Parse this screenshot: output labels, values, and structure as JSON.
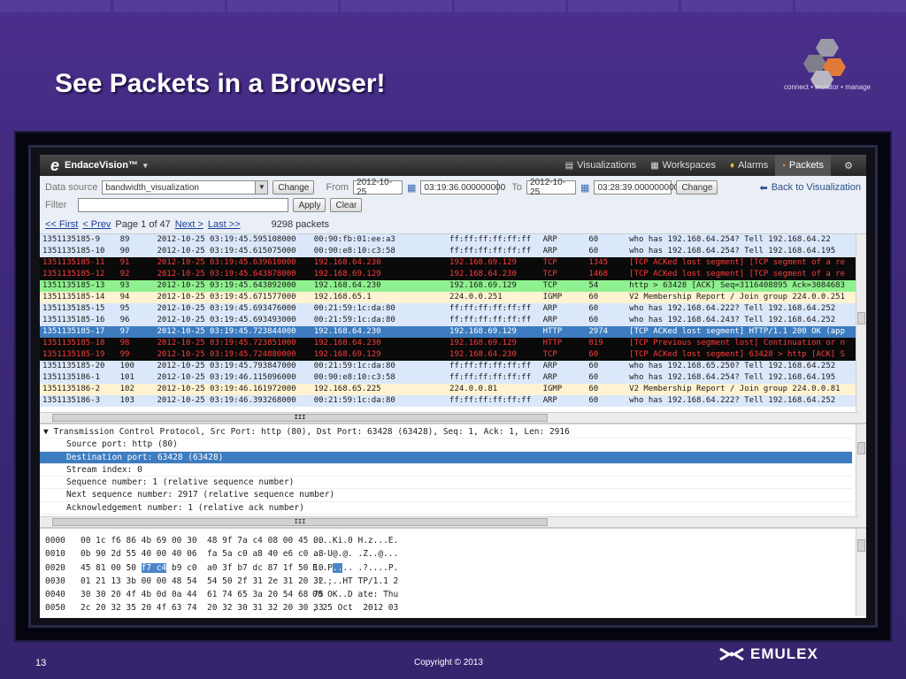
{
  "slide": {
    "title": "See Packets in a Browser!",
    "tagline": "connect • monitor • manage",
    "page_number": "13",
    "copyright": "Copyright © 2013",
    "company": "EMULEX"
  },
  "app": {
    "name": "EndaceVision™",
    "nav": [
      {
        "label": "Visualizations",
        "icon": "chart-icon"
      },
      {
        "label": "Workspaces",
        "icon": "grid-icon"
      },
      {
        "label": "Alarms",
        "icon": "bell-icon"
      },
      {
        "label": "Packets",
        "icon": "packets-icon"
      }
    ]
  },
  "controls": {
    "data_source_label": "Data source",
    "data_source_value": "bandwidth_visualization",
    "change_label": "Change",
    "from_label": "From",
    "from_date": "2012-10-25",
    "from_time": "03:19:36.000000000",
    "to_label": "To",
    "to_date": "2012-10-25",
    "to_time": "03:28:39.000000000",
    "change2_label": "Change",
    "back_label": "Back to Visualization",
    "filter_label": "Filter",
    "filter_value": "",
    "apply_label": "Apply",
    "clear_label": "Clear",
    "first_label": "<< First",
    "prev_label": "< Prev",
    "page_text": "Page 1 of 47",
    "next_label": "Next >",
    "last_label": "Last >>",
    "packet_count": "9298 packets"
  },
  "packets": [
    {
      "id": "1351135185-9",
      "no": "89",
      "time": "2012-10-25 03:19:45.595108000",
      "src": "00:90:fb:01:ee:a3",
      "dst": "ff:ff:ff:ff:ff:ff",
      "proto": "ARP",
      "len": "60",
      "info": "who has 192.168.64.254? Tell 192.168.64.22",
      "bg": "#dbe8fb",
      "fg": "#1a1a1a"
    },
    {
      "id": "1351135185-10",
      "no": "90",
      "time": "2012-10-25 03:19:45.615075000",
      "src": "00:90:e8:10:c3:58",
      "dst": "ff:ff:ff:ff:ff:ff",
      "proto": "ARP",
      "len": "60",
      "info": "who has 192.168.64.254? Tell 192.168.64.195",
      "bg": "#dbe8fb",
      "fg": "#1a1a1a"
    },
    {
      "id": "1351135185-11",
      "no": "91",
      "time": "2012-10-25 03:19:45.639610000",
      "src": "192.168.64.230",
      "dst": "192.168.69.129",
      "proto": "TCP",
      "len": "1345",
      "info": "[TCP ACKed lost segment] [TCP segment of a re",
      "bg": "#0a0a0a",
      "fg": "#ff3b3b"
    },
    {
      "id": "1351135185-12",
      "no": "92",
      "time": "2012-10-25 03:19:45.643878000",
      "src": "192.168.69.129",
      "dst": "192.168.64.230",
      "proto": "TCP",
      "len": "1468",
      "info": "[TCP ACKed lost segment] [TCP segment of a re",
      "bg": "#0a0a0a",
      "fg": "#ff3b3b"
    },
    {
      "id": "1351135185-13",
      "no": "93",
      "time": "2012-10-25 03:19:45.643892000",
      "src": "192.168.64.230",
      "dst": "192.168.69.129",
      "proto": "TCP",
      "len": "54",
      "info": "http > 63428 [ACK] Seq=3116408895 Ack=3084683",
      "bg": "#8ef08e",
      "fg": "#1a1a1a"
    },
    {
      "id": "1351135185-14",
      "no": "94",
      "time": "2012-10-25 03:19:45.671577000",
      "src": "192.168.65.1",
      "dst": "224.0.0.251",
      "proto": "IGMP",
      "len": "60",
      "info": "V2 Membership Report / Join group 224.0.0.251",
      "bg": "#fff3d2",
      "fg": "#1a1a1a"
    },
    {
      "id": "1351135185-15",
      "no": "95",
      "time": "2012-10-25 03:19:45.693476000",
      "src": "00:21:59:1c:da:80",
      "dst": "ff:ff:ff:ff:ff:ff",
      "proto": "ARP",
      "len": "60",
      "info": "who has 192.168.64.222? Tell 192.168.64.252",
      "bg": "#dbe8fb",
      "fg": "#1a1a1a"
    },
    {
      "id": "1351135185-16",
      "no": "96",
      "time": "2012-10-25 03:19:45.693493000",
      "src": "00:21:59:1c:da:80",
      "dst": "ff:ff:ff:ff:ff:ff",
      "proto": "ARP",
      "len": "60",
      "info": "who has 192.168.64.243? Tell 192.168.64.252",
      "bg": "#dbe8fb",
      "fg": "#1a1a1a"
    },
    {
      "id": "1351135185-17",
      "no": "97",
      "time": "2012-10-25 03:19:45.723844000",
      "src": "192.168.64.230",
      "dst": "192.168.69.129",
      "proto": "HTTP",
      "len": "2974",
      "info": "[TCP ACKed lost segment] HTTP/1.1 200 OK (app",
      "bg": "#3d7cc0",
      "fg": "#ffffff"
    },
    {
      "id": "1351135185-18",
      "no": "98",
      "time": "2012-10-25 03:19:45.723851000",
      "src": "192.168.64.230",
      "dst": "192.168.69.129",
      "proto": "HTTP",
      "len": "819",
      "info": "[TCP Previous segment lost] Continuation or n",
      "bg": "#0a0a0a",
      "fg": "#ff3b3b"
    },
    {
      "id": "1351135185-19",
      "no": "99",
      "time": "2012-10-25 03:19:45.724880000",
      "src": "192.168.69.129",
      "dst": "192.168.64.230",
      "proto": "TCP",
      "len": "60",
      "info": "[TCP ACKed lost segment] 63428 > http [ACK] S",
      "bg": "#0a0a0a",
      "fg": "#ff3b3b"
    },
    {
      "id": "1351135185-20",
      "no": "100",
      "time": "2012-10-25 03:19:45.793847000",
      "src": "00:21:59:1c:da:80",
      "dst": "ff:ff:ff:ff:ff:ff",
      "proto": "ARP",
      "len": "60",
      "info": "who has 192.168.65.250? Tell 192.168.64.252",
      "bg": "#dbe8fb",
      "fg": "#1a1a1a"
    },
    {
      "id": "1351135186-1",
      "no": "101",
      "time": "2012-10-25 03:19:46.115096000",
      "src": "00:90:e8:10:c3:58",
      "dst": "ff:ff:ff:ff:ff:ff",
      "proto": "ARP",
      "len": "60",
      "info": "who has 192.168.64.254? Tell 192.168.64.195",
      "bg": "#dbe8fb",
      "fg": "#1a1a1a"
    },
    {
      "id": "1351135186-2",
      "no": "102",
      "time": "2012-10-25 03:19:46.161972000",
      "src": "192.168.65.225",
      "dst": "224.0.0.81",
      "proto": "IGMP",
      "len": "60",
      "info": "V2 Membership Report / Join group 224.0.0.81",
      "bg": "#fff3d2",
      "fg": "#1a1a1a"
    },
    {
      "id": "1351135186-3",
      "no": "103",
      "time": "2012-10-25 03:19:46.393268000",
      "src": "00:21:59:1c:da:80",
      "dst": "ff:ff:ff:ff:ff:ff",
      "proto": "ARP",
      "len": "60",
      "info": "who has 192.168.64.222? Tell 192.168.64.252",
      "bg": "#dbe8fb",
      "fg": "#1a1a1a"
    }
  ],
  "scroll_glyph": "III",
  "details": [
    {
      "text": "▼ Transmission Control Protocol, Src Port: http (80), Dst Port: 63428 (63428), Seq: 1, Ack: 1, Len: 2916",
      "indent": 0,
      "selected": false
    },
    {
      "text": "Source port: http (80)",
      "indent": 1,
      "selected": false
    },
    {
      "text": "Destination port: 63428 (63428)",
      "indent": 1,
      "selected": true
    },
    {
      "text": "Stream index: 0",
      "indent": 1,
      "selected": false
    },
    {
      "text": "Sequence number: 1 (relative sequence number)",
      "indent": 1,
      "selected": false
    },
    {
      "text": "Next sequence number: 2917 (relative sequence number)",
      "indent": 1,
      "selected": false
    },
    {
      "text": "Acknowledgement number: 1 (relative ack number)",
      "indent": 1,
      "selected": false
    }
  ],
  "hex": [
    {
      "offset": "0000",
      "pre": "00 1c f6 86 4b 69 00 30  48 9f 7a c4 08 00 45 00",
      "hl": "",
      "post": "",
      "ascii_pre": "....Ki.0 H.z...E.",
      "ascii_hl": "",
      "ascii_post": ""
    },
    {
      "offset": "0010",
      "pre": "0b 90 2d 55 40 00 40 06  fa 5a c0 a8 40 e6 c0 a8",
      "hl": "",
      "post": "",
      "ascii_pre": "..-U@.@. .Z..@...",
      "ascii_hl": "",
      "ascii_post": ""
    },
    {
      "offset": "0020",
      "pre": "45 81 00 50 ",
      "hl": "f7 c4",
      "post": " b9 c0  a0 3f b7 dc 87 1f 50 10",
      "ascii_pre": "E..P",
      "ascii_hl": "..",
      "ascii_post": ".. .?....P.",
      "note": "highlighted bytes"
    },
    {
      "offset": "0030",
      "pre": "01 21 13 3b 00 00 48 54  54 50 2f 31 2e 31 20 32",
      "hl": "",
      "post": "",
      "ascii_pre": ".!.;..HT TP/1.1 2",
      "ascii_hl": "",
      "ascii_post": ""
    },
    {
      "offset": "0040",
      "pre": "30 30 20 4f 4b 0d 0a 44  61 74 65 3a 20 54 68 75",
      "hl": "",
      "post": "",
      "ascii_pre": "00 OK..D ate: Thu",
      "ascii_hl": "",
      "ascii_post": ""
    },
    {
      "offset": "0050",
      "pre": "2c 20 32 35 20 4f 63 74  20 32 30 31 32 20 30 33",
      "hl": "",
      "post": "",
      "ascii_pre": ", 25 Oct  2012 03",
      "ascii_hl": "",
      "ascii_post": ""
    }
  ]
}
